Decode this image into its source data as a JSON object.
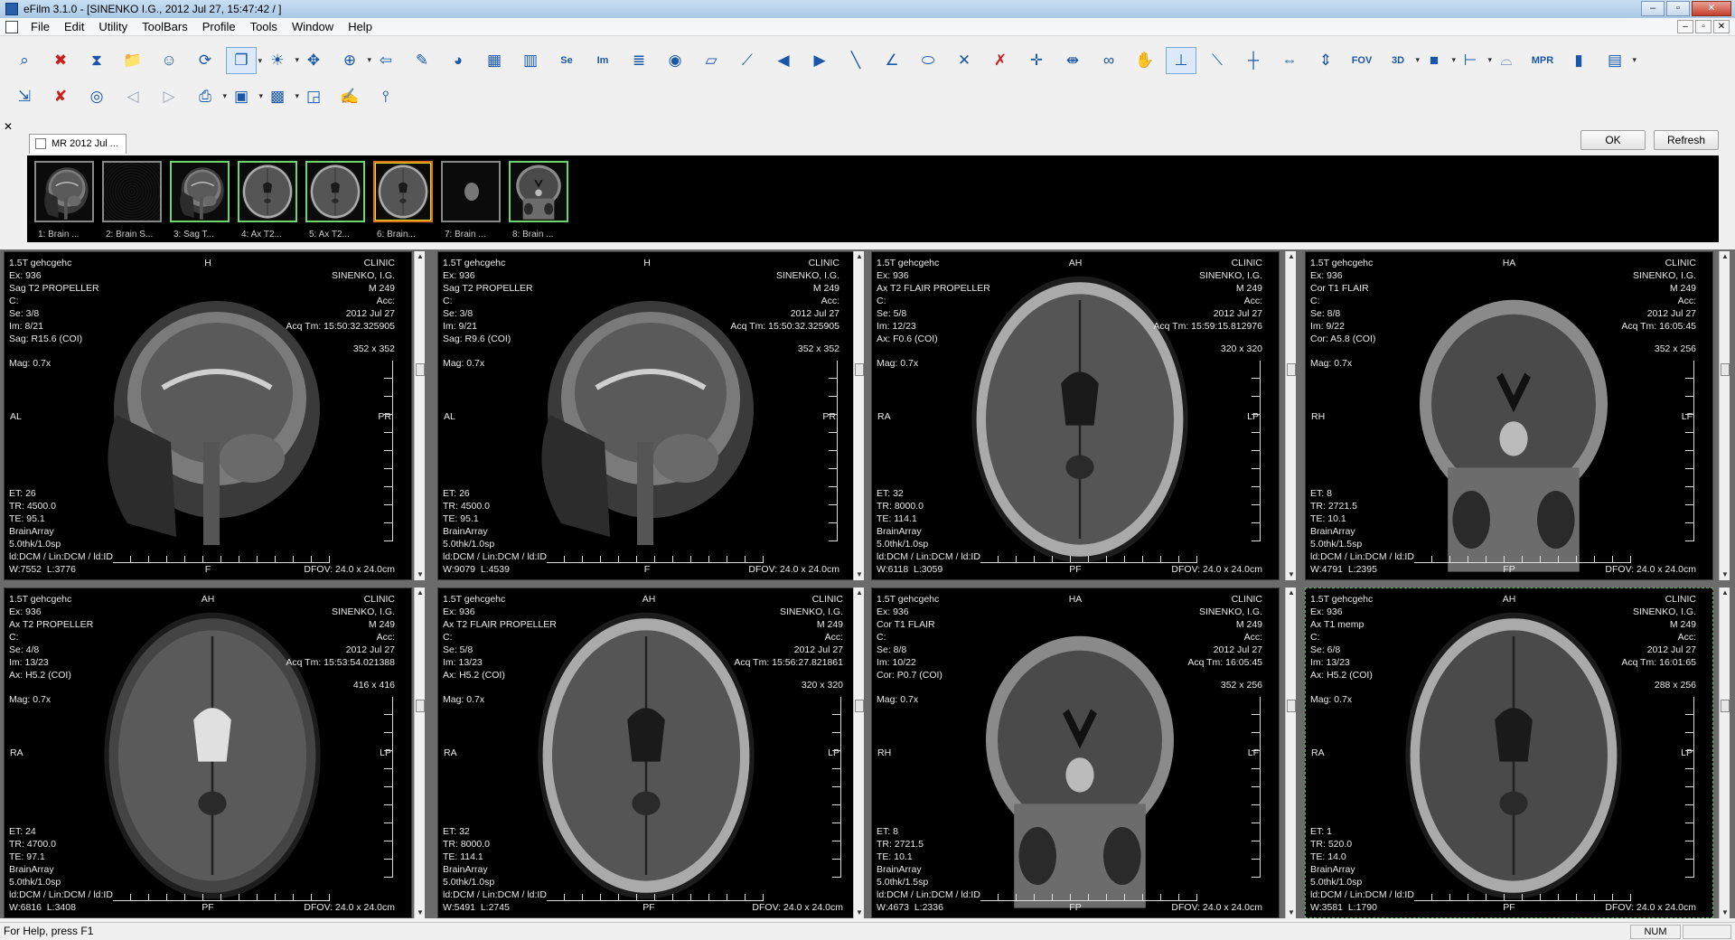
{
  "window": {
    "title": "eFilm 3.1.0 - [SINENKO I.G., 2012 Jul 27, 15:47:42  /  ]"
  },
  "menu": [
    "File",
    "Edit",
    "Utility",
    "ToolBars",
    "Profile",
    "Tools",
    "Window",
    "Help"
  ],
  "toolbar1": [
    {
      "name": "search-study-icon",
      "glyph": "⌕"
    },
    {
      "name": "delete-icon",
      "glyph": "✖"
    },
    {
      "name": "hourglass-icon",
      "glyph": "⧗"
    },
    {
      "name": "open-folder-icon",
      "glyph": "📁"
    },
    {
      "name": "patient-icon",
      "glyph": "☺"
    },
    {
      "name": "refresh-icon",
      "glyph": "⟳"
    },
    {
      "name": "windows-icon",
      "glyph": "❐"
    },
    {
      "name": "brightness-icon",
      "glyph": "☀"
    },
    {
      "name": "pan-icon",
      "glyph": "✥"
    },
    {
      "name": "zoom-icon",
      "glyph": "⊕"
    },
    {
      "name": "back-icon",
      "glyph": "⇦"
    },
    {
      "name": "edit-icon",
      "glyph": "✎"
    },
    {
      "name": "palette-icon",
      "glyph": "◕"
    },
    {
      "name": "layout-icon",
      "glyph": "▦"
    },
    {
      "name": "tile-icon",
      "glyph": "▥"
    },
    {
      "name": "series-icon",
      "glyph": "Se"
    },
    {
      "name": "image-icon",
      "glyph": "Im"
    },
    {
      "name": "notes-icon",
      "glyph": "≣"
    },
    {
      "name": "eye-icon",
      "glyph": "◉"
    },
    {
      "name": "ruler-icon",
      "glyph": "▱"
    },
    {
      "name": "measure-icon",
      "glyph": "⟋"
    },
    {
      "name": "prev-study-icon",
      "glyph": "◀"
    },
    {
      "name": "next-study-icon",
      "glyph": "▶"
    },
    {
      "name": "line-icon",
      "glyph": "╲"
    },
    {
      "name": "angle-icon",
      "glyph": "∠"
    },
    {
      "name": "ellipse-icon",
      "glyph": "⬭"
    },
    {
      "name": "cobb-icon",
      "glyph": "✕"
    },
    {
      "name": "erase-icon",
      "glyph": "✗"
    },
    {
      "name": "crosshair-icon",
      "glyph": "✛"
    },
    {
      "name": "sync-icon",
      "glyph": "⇼"
    },
    {
      "name": "link-icon",
      "glyph": "∞"
    },
    {
      "name": "hand-icon",
      "glyph": "✋"
    },
    {
      "name": "axis-icon",
      "glyph": "⊥"
    },
    {
      "name": "mpr-line-icon",
      "glyph": "⟍"
    },
    {
      "name": "cross-ref-icon",
      "glyph": "┼"
    },
    {
      "name": "flip-h-icon",
      "glyph": "⇔"
    },
    {
      "name": "flip-v-icon",
      "glyph": "⇕"
    },
    {
      "name": "fov-icon",
      "glyph": "FOV"
    },
    {
      "name": "3d-icon",
      "glyph": "3D"
    },
    {
      "name": "box-icon",
      "glyph": "■"
    },
    {
      "name": "coords-icon",
      "glyph": "⊢"
    },
    {
      "name": "glasses-icon",
      "glyph": "⌓"
    },
    {
      "name": "mpr-icon",
      "glyph": "MPR"
    },
    {
      "name": "histogram-icon",
      "glyph": "▮"
    },
    {
      "name": "film-icon",
      "glyph": "▤"
    }
  ],
  "toolbar2": [
    {
      "name": "export-icon",
      "glyph": "⇲"
    },
    {
      "name": "remove-icon",
      "glyph": "✘"
    },
    {
      "name": "cd-icon",
      "glyph": "◎"
    },
    {
      "name": "rotate-left-icon",
      "glyph": "◁"
    },
    {
      "name": "rotate-right-icon",
      "glyph": "▷"
    },
    {
      "name": "print-icon",
      "glyph": "⎙"
    },
    {
      "name": "color-map-icon",
      "glyph": "▣"
    },
    {
      "name": "report-icon",
      "glyph": "▩"
    },
    {
      "name": "key-image-icon",
      "glyph": "◲"
    },
    {
      "name": "annotate-icon",
      "glyph": "✍"
    },
    {
      "name": "probe-icon",
      "glyph": "⫯"
    }
  ],
  "study": {
    "tab_label": "MR 2012 Jul ...",
    "ok_label": "OK",
    "refresh_label": "Refresh",
    "thumbnails": [
      {
        "caption": "1: Brain ...",
        "state": "normal",
        "kind": "sag"
      },
      {
        "caption": "2: Brain S...",
        "state": "normal",
        "kind": "noise"
      },
      {
        "caption": "3: Sag T...",
        "state": "sel",
        "kind": "sag"
      },
      {
        "caption": "4: Ax T2...",
        "state": "sel",
        "kind": "ax"
      },
      {
        "caption": "5: Ax T2...",
        "state": "sel",
        "kind": "ax"
      },
      {
        "caption": "6: Brain...",
        "state": "cur",
        "kind": "ax"
      },
      {
        "caption": "7: Brain ...",
        "state": "normal",
        "kind": "dot"
      },
      {
        "caption": "8: Brain ...",
        "state": "sel",
        "kind": "cor"
      }
    ]
  },
  "viewports": [
    {
      "kind": "sag",
      "tl": "1.5T gehcgehc\nEx: 936\nSag T2 PROPELLER\nC:\nSe: 3/8\nIm: 8/21\nSag: R15.6 (COI)",
      "tr": "CLINIC\nSINENKO, I.G.\nM 249\nAcc:\n2012 Jul 27\nAcq Tm: 15:50:32.325905",
      "mag": "Mag: 0.7x",
      "matrix": "352 x 352",
      "top": "H",
      "bottom": "F",
      "left": "AL",
      "right": "PR",
      "bl": "ET: 26\nTR: 4500.0\nTE: 95.1\nBrainArray\n5.0thk/1.0sp\nld:DCM / Lin:DCM / ld:ID\nW:7552  L:3776",
      "br": "DFOV: 24.0 x 24.0cm"
    },
    {
      "kind": "sag2",
      "tl": "1.5T gehcgehc\nEx: 936\nSag T2 PROPELLER\nC:\nSe: 3/8\nIm: 9/21\nSag: R9.6 (COI)",
      "tr": "CLINIC\nSINENKO, I.G.\nM 249\nAcc:\n2012 Jul 27\nAcq Tm: 15:50:32.325905",
      "mag": "Mag: 0.7x",
      "matrix": "352 x 352",
      "top": "H",
      "bottom": "F",
      "left": "AL",
      "right": "PR",
      "bl": "ET: 26\nTR: 4500.0\nTE: 95.1\nBrainArray\n5.0thk/1.0sp\nld:DCM / Lin:DCM / ld:ID\nW:9079  L:4539",
      "br": "DFOV: 24.0 x 24.0cm"
    },
    {
      "kind": "ax-flair",
      "tl": "1.5T gehcgehc\nEx: 936\nAx T2 FLAIR PROPELLER\nC:\nSe: 5/8\nIm: 12/23\nAx: F0.6 (COI)",
      "tr": "CLINIC\nSINENKO, I.G.\nM 249\nAcc:\n2012 Jul 27\nAcq Tm: 15:59:15.812976",
      "mag": "Mag: 0.7x",
      "matrix": "320 x 320",
      "top": "AH",
      "bottom": "PF",
      "left": "RA",
      "right": "LP",
      "bl": "ET: 32\nTR: 8000.0\nTE: 114.1\nBrainArray\n5.0thk/1.0sp\nld:DCM / Lin:DCM / ld:ID\nW:6118  L:3059",
      "br": "DFOV: 24.0 x 24.0cm"
    },
    {
      "kind": "cor",
      "tl": "1.5T gehcgehc\nEx: 936\nCor T1 FLAIR\nC:\nSe: 8/8\nIm: 9/22\nCor: A5.8 (COI)",
      "tr": "CLINIC\nSINENKO, I.G.\nM 249\nAcc:\n2012 Jul 27\nAcq Tm: 16:05:45",
      "mag": "Mag: 0.7x",
      "matrix": "352 x 256",
      "top": "HA",
      "bottom": "FP",
      "left": "RH",
      "right": "LF",
      "bl": "ET: 8\nTR: 2721.5\nTE: 10.1\nBrainArray\n5.0thk/1.5sp\nld:DCM / Lin:DCM / ld:ID\nW:4791  L:2395",
      "br": "DFOV: 24.0 x 24.0cm"
    },
    {
      "kind": "ax-t2",
      "tl": "1.5T gehcgehc\nEx: 936\nAx T2 PROPELLER\nC:\nSe: 4/8\nIm: 13/23\nAx: H5.2 (COI)",
      "tr": "CLINIC\nSINENKO, I.G.\nM 249\nAcc:\n2012 Jul 27\nAcq Tm: 15:53:54.021388",
      "mag": "Mag: 0.7x",
      "matrix": "416 x 416",
      "top": "AH",
      "bottom": "PF",
      "left": "RA",
      "right": "LP",
      "bl": "ET: 24\nTR: 4700.0\nTE: 97.1\nBrainArray\n5.0thk/1.0sp\nld:DCM / Lin:DCM / ld:ID\nW:6816  L:3408",
      "br": "DFOV: 24.0 x 24.0cm"
    },
    {
      "kind": "ax-flair",
      "tl": "1.5T gehcgehc\nEx: 936\nAx T2 FLAIR PROPELLER\nC:\nSe: 5/8\nIm: 13/23\nAx: H5.2 (COI)",
      "tr": "CLINIC\nSINENKO, I.G.\nM 249\nAcc:\n2012 Jul 27\nAcq Tm: 15:56:27.821861",
      "mag": "Mag: 0.7x",
      "matrix": "320 x 320",
      "top": "AH",
      "bottom": "PF",
      "left": "RA",
      "right": "LP",
      "bl": "ET: 32\nTR: 8000.0\nTE: 114.1\nBrainArray\n5.0thk/1.0sp\nld:DCM / Lin:DCM / ld:ID\nW:5491  L:2745",
      "br": "DFOV: 24.0 x 24.0cm"
    },
    {
      "kind": "cor",
      "tl": "1.5T gehcgehc\nEx: 936\nCor T1 FLAIR\nC:\nSe: 8/8\nIm: 10/22\nCor: P0.7 (COI)",
      "tr": "CLINIC\nSINENKO, I.G.\nM 249\nAcc:\n2012 Jul 27\nAcq Tm: 16:05:45",
      "mag": "Mag: 0.7x",
      "matrix": "352 x 256",
      "top": "HA",
      "bottom": "FP",
      "left": "RH",
      "right": "LF",
      "bl": "ET: 8\nTR: 2721.5\nTE: 10.1\nBrainArray\n5.0thk/1.5sp\nld:DCM / Lin:DCM / ld:ID\nW:4673  L:2336",
      "br": "DFOV: 24.0 x 24.0cm"
    },
    {
      "kind": "ax-t1",
      "tl": "1.5T gehcgehc\nEx: 936\nAx T1 memp\nC:\nSe: 6/8\nIm: 13/23\nAx: H5.2 (COI)",
      "tr": "CLINIC\nSINENKO, I.G.\nM 249\nAcc:\n2012 Jul 27\nAcq Tm: 16:01:65",
      "mag": "Mag: 0.7x",
      "matrix": "288 x 256",
      "top": "AH",
      "bottom": "PF",
      "left": "RA",
      "right": "LP",
      "bl": "ET: 1\nTR: 520.0\nTE: 14.0\nBrainArray\n5.0thk/1.0sp\nld:DCM / Lin:DCM / ld:ID\nW:3581  L:1790",
      "br": "DFOV: 24.0 x 24.0cm"
    }
  ],
  "status": {
    "help": "For Help, press F1",
    "num": "NUM"
  }
}
